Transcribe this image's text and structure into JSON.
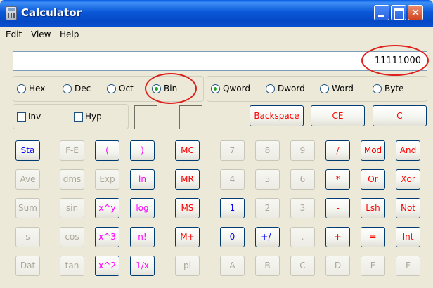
{
  "window": {
    "title": "Calculator",
    "controls": {
      "minimize": "minimize",
      "maximize": "maximize",
      "close": "✕"
    }
  },
  "menu": [
    "Edit",
    "View",
    "Help"
  ],
  "display": {
    "value": "11111000"
  },
  "base_radios": [
    {
      "label": "Hex",
      "checked": false
    },
    {
      "label": "Dec",
      "checked": false
    },
    {
      "label": "Oct",
      "checked": false
    },
    {
      "label": "Bin",
      "checked": true
    }
  ],
  "word_radios": [
    {
      "label": "Qword",
      "checked": true
    },
    {
      "label": "Dword",
      "checked": false
    },
    {
      "label": "Word",
      "checked": false
    },
    {
      "label": "Byte",
      "checked": false
    }
  ],
  "checkboxes": [
    {
      "label": "Inv",
      "checked": false
    },
    {
      "label": "Hyp",
      "checked": false
    }
  ],
  "top_buttons": [
    "Backspace",
    "CE",
    "C"
  ],
  "keys": [
    [
      {
        "l": "Sta",
        "c": "blue"
      },
      {
        "l": "F-E",
        "c": "off"
      },
      {
        "l": "(",
        "c": "mag"
      },
      {
        "l": ")",
        "c": "mag"
      },
      {
        "l": "MC",
        "c": "red"
      },
      {
        "l": "7",
        "c": "off"
      },
      {
        "l": "8",
        "c": "off"
      },
      {
        "l": "9",
        "c": "off"
      },
      {
        "l": "/",
        "c": "red"
      },
      {
        "l": "Mod",
        "c": "red"
      },
      {
        "l": "And",
        "c": "red"
      }
    ],
    [
      {
        "l": "Ave",
        "c": "off"
      },
      {
        "l": "dms",
        "c": "off"
      },
      {
        "l": "Exp",
        "c": "off"
      },
      {
        "l": "ln",
        "c": "mag"
      },
      {
        "l": "MR",
        "c": "red"
      },
      {
        "l": "4",
        "c": "off"
      },
      {
        "l": "5",
        "c": "off"
      },
      {
        "l": "6",
        "c": "off"
      },
      {
        "l": "*",
        "c": "red"
      },
      {
        "l": "Or",
        "c": "red"
      },
      {
        "l": "Xor",
        "c": "red"
      }
    ],
    [
      {
        "l": "Sum",
        "c": "off"
      },
      {
        "l": "sin",
        "c": "off"
      },
      {
        "l": "x^y",
        "c": "mag"
      },
      {
        "l": "log",
        "c": "mag"
      },
      {
        "l": "MS",
        "c": "red"
      },
      {
        "l": "1",
        "c": "blue"
      },
      {
        "l": "2",
        "c": "off"
      },
      {
        "l": "3",
        "c": "off"
      },
      {
        "l": "-",
        "c": "red"
      },
      {
        "l": "Lsh",
        "c": "red"
      },
      {
        "l": "Not",
        "c": "red"
      }
    ],
    [
      {
        "l": "s",
        "c": "off"
      },
      {
        "l": "cos",
        "c": "off"
      },
      {
        "l": "x^3",
        "c": "mag"
      },
      {
        "l": "n!",
        "c": "mag"
      },
      {
        "l": "M+",
        "c": "red"
      },
      {
        "l": "0",
        "c": "blue"
      },
      {
        "l": "+/-",
        "c": "blue"
      },
      {
        "l": ".",
        "c": "off"
      },
      {
        "l": "+",
        "c": "red"
      },
      {
        "l": "=",
        "c": "red"
      },
      {
        "l": "Int",
        "c": "red"
      }
    ],
    [
      {
        "l": "Dat",
        "c": "off"
      },
      {
        "l": "tan",
        "c": "off"
      },
      {
        "l": "x^2",
        "c": "mag"
      },
      {
        "l": "1/x",
        "c": "mag"
      },
      {
        "l": "pi",
        "c": "off"
      },
      {
        "l": "A",
        "c": "off"
      },
      {
        "l": "B",
        "c": "off"
      },
      {
        "l": "C",
        "c": "off"
      },
      {
        "l": "D",
        "c": "off"
      },
      {
        "l": "E",
        "c": "off"
      },
      {
        "l": "F",
        "c": "off"
      }
    ]
  ],
  "colors": {
    "annotation": "#e0201c",
    "titlebar": "#0a58d8",
    "face": "#ece9d8"
  }
}
